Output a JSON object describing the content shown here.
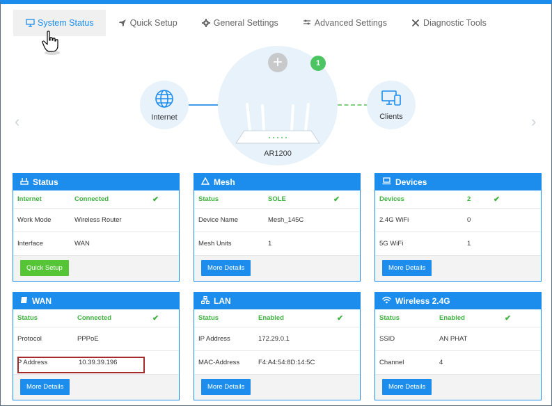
{
  "tabs": [
    {
      "label": "System Status",
      "icon": "monitor-icon",
      "active": true
    },
    {
      "label": "Quick Setup",
      "icon": "rocket-icon"
    },
    {
      "label": "General Settings",
      "icon": "gear-icon"
    },
    {
      "label": "Advanced Settings",
      "icon": "sliders-icon"
    },
    {
      "label": "Diagnostic Tools",
      "icon": "tools-icon"
    }
  ],
  "topology": {
    "internet_label": "Internet",
    "router_label": "AR1200",
    "clients_label": "Clients",
    "clients_badge": "1"
  },
  "cards": {
    "status": {
      "title": "Status",
      "rows": [
        {
          "k": "Internet",
          "v": "Connected",
          "check": true
        },
        {
          "k": "Work Mode",
          "v": "Wireless Router"
        },
        {
          "k": "Interface",
          "v": "WAN"
        }
      ],
      "button": "Quick Setup"
    },
    "mesh": {
      "title": "Mesh",
      "rows": [
        {
          "k": "Status",
          "v": "SOLE",
          "check": true
        },
        {
          "k": "Device Name",
          "v": "Mesh_145C"
        },
        {
          "k": "Mesh Units",
          "v": "1"
        }
      ],
      "button": "More Details"
    },
    "devices": {
      "title": "Devices",
      "rows": [
        {
          "k": "Devices",
          "v": "2",
          "check": true
        },
        {
          "k": "2.4G WiFi",
          "v": "0"
        },
        {
          "k": "5G WiFi",
          "v": "1"
        }
      ],
      "button": "More Details"
    },
    "wan": {
      "title": "WAN",
      "rows": [
        {
          "k": "Status",
          "v": "Connected",
          "check": true
        },
        {
          "k": "Protocol",
          "v": "PPPoE"
        },
        {
          "k": "P Address",
          "v": "10.39.39.196"
        }
      ],
      "button": "More Details"
    },
    "lan": {
      "title": "LAN",
      "rows": [
        {
          "k": "Status",
          "v": "Enabled",
          "check": true
        },
        {
          "k": "IP Address",
          "v": "172.29.0.1"
        },
        {
          "k": "MAC-Address",
          "v": "F4:A4:54:8D:14:5C"
        }
      ],
      "button": "More Details"
    },
    "wireless": {
      "title": "Wireless 2.4G",
      "rows": [
        {
          "k": "Status",
          "v": "Enabled",
          "check": true
        },
        {
          "k": "SSID",
          "v": "AN PHAT"
        },
        {
          "k": "Channel",
          "v": "4"
        }
      ],
      "button": "More Details"
    }
  },
  "colors": {
    "accent": "#1c8ded",
    "ok": "#3eb23e",
    "highlight": "#a52a2a"
  }
}
